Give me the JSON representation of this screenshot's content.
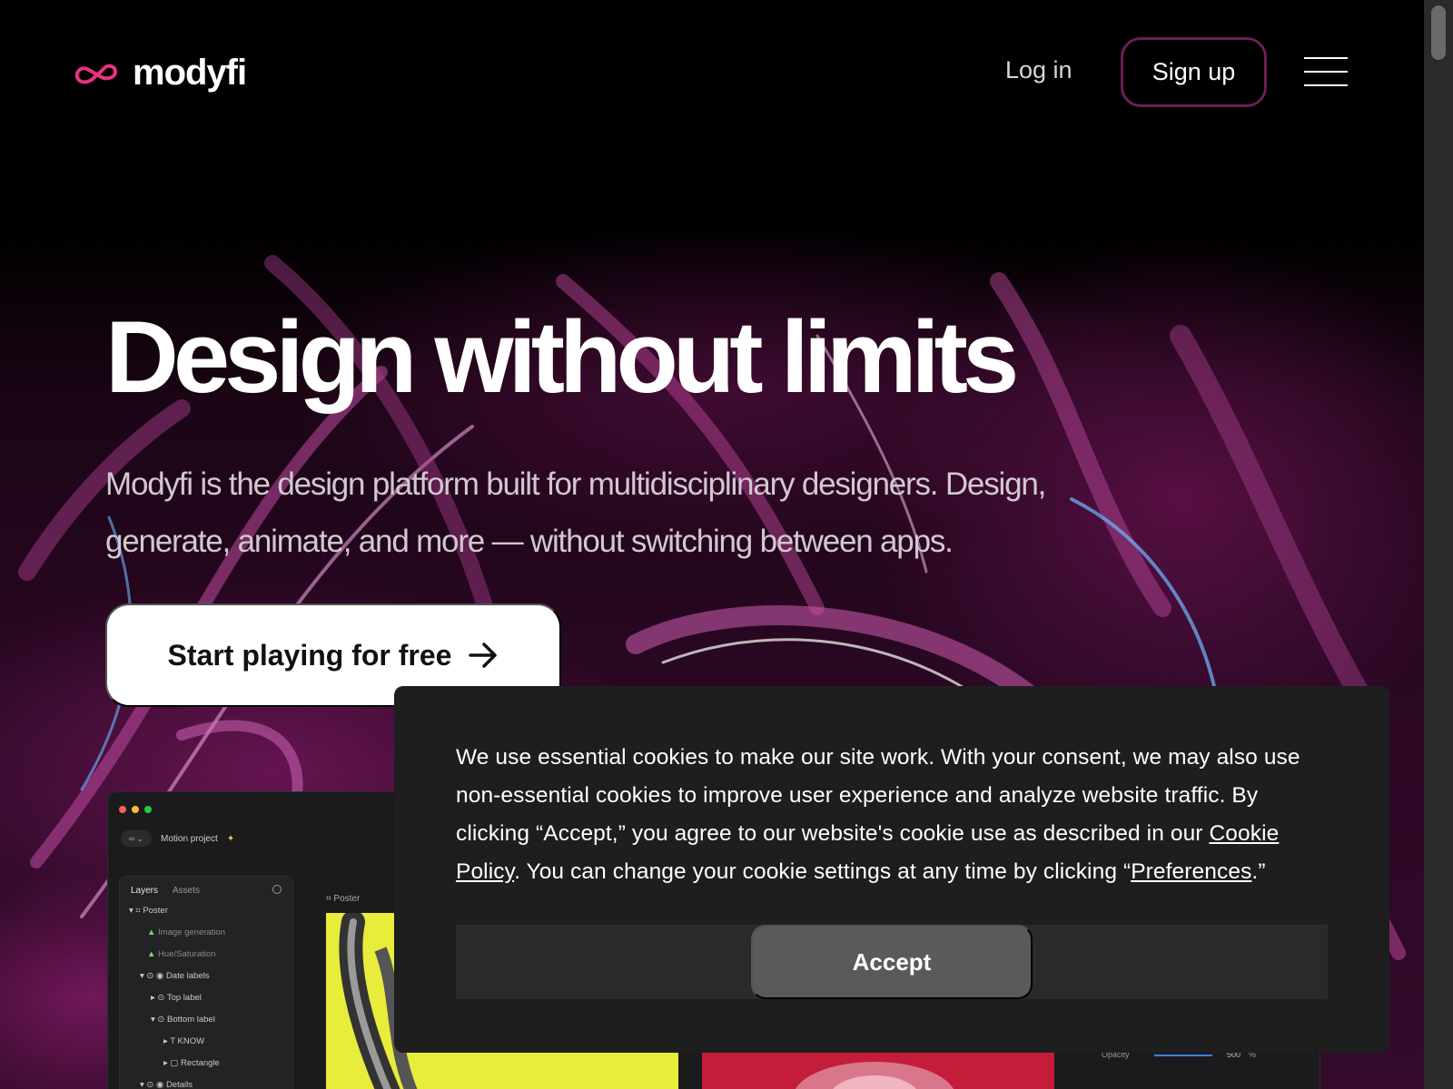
{
  "brand": {
    "name": "modyfi",
    "accent": "#e8337f"
  },
  "header": {
    "login_label": "Log in",
    "signup_label": "Sign up",
    "menu_icon": "hamburger-icon"
  },
  "hero": {
    "title": "Design without limits",
    "subtitle": "Modyfi is the design platform built for multidisciplinary designers. Design, generate, animate, and more — without switching between apps.",
    "cta_label": "Start playing for free",
    "cta_icon": "arrow-right-icon"
  },
  "preview": {
    "project_name": "Motion project",
    "tabs": [
      "Layers",
      "Assets"
    ],
    "canvas_label": "Poster",
    "layers": [
      {
        "label": "Poster"
      },
      {
        "label": "Image generation"
      },
      {
        "label": "Hue/Saturation"
      },
      {
        "label": "Date labels"
      },
      {
        "label": "Top label"
      },
      {
        "label": "Bottom label"
      },
      {
        "label": "KNOW"
      },
      {
        "label": "Rectangle"
      },
      {
        "label": "Details"
      }
    ],
    "opacity_label": "Opacity",
    "opacity_value": "500",
    "opacity_unit": "%"
  },
  "cookie": {
    "text_before": "We use essential cookies to make our site work. With your consent, we may also use non-essential cookies to improve user experience and analyze website traffic. By clicking “Accept,” you agree to our website's cookie use as described in our ",
    "policy_link": "Cookie Policy",
    "text_middle": ". You can change your cookie settings at any time by clicking “",
    "preferences_link": "Preferences",
    "text_after": ".”",
    "accept_label": "Accept"
  }
}
